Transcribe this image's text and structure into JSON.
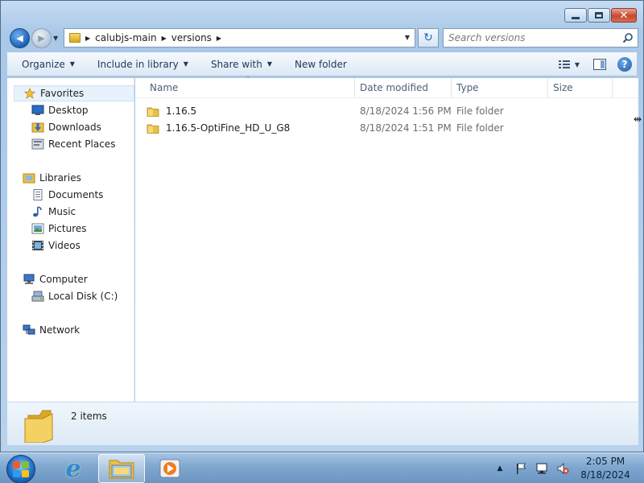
{
  "window": {
    "caption_buttons": {
      "minimize_icon": "minimize-icon",
      "maximize_icon": "maximize-icon",
      "close_symbol": "✕"
    }
  },
  "address": {
    "back_symbol": "◀",
    "forward_symbol": "▶",
    "crumbs": [
      "calubjs-main",
      "versions"
    ],
    "crumb_separator": "▶",
    "refresh_symbol": "↻"
  },
  "search": {
    "placeholder": "Search versions"
  },
  "toolbar": {
    "organize": "Organize",
    "include_in_library": "Include in library",
    "share_with": "Share with",
    "new_folder": "New folder",
    "caret": "▼",
    "help": "?"
  },
  "nav": {
    "favorites": {
      "label": "Favorites",
      "items": [
        "Desktop",
        "Downloads",
        "Recent Places"
      ]
    },
    "libraries": {
      "label": "Libraries",
      "items": [
        "Documents",
        "Music",
        "Pictures",
        "Videos"
      ]
    },
    "computer": {
      "label": "Computer",
      "items": [
        "Local Disk (C:)"
      ]
    },
    "network": {
      "label": "Network"
    }
  },
  "columns": {
    "name": "Name",
    "date_modified": "Date modified",
    "type": "Type",
    "size": "Size",
    "sort_indicator": "^"
  },
  "files": [
    {
      "name": "1.16.5",
      "date": "8/18/2024 1:56 PM",
      "type": "File folder"
    },
    {
      "name": "1.16.5-OptiFine_HD_U_G8",
      "date": "8/18/2024 1:51 PM",
      "type": "File folder"
    }
  ],
  "details": {
    "count": "2 items"
  },
  "taskbar": {
    "ie_glyph": "e",
    "tray_show_hidden": "▲",
    "clock_time": "2:05 PM",
    "clock_date": "8/18/2024"
  },
  "colors": {
    "accent": "#1f6ec9",
    "folder": "#e8c048",
    "taskbar": "#7fa7d0"
  }
}
